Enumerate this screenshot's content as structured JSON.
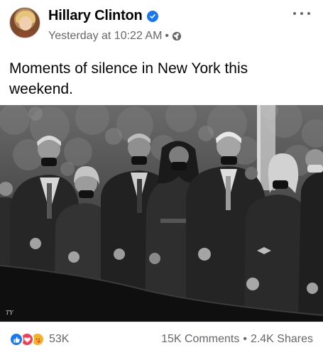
{
  "post": {
    "author": "Hillary Clinton",
    "timestamp": "Yesterday at 10:22 AM",
    "separator": "•",
    "caption": "Moments of silence in New York this weekend.",
    "photo_signature": "TY"
  },
  "footer": {
    "reaction_count": "53K",
    "comments": "15K Comments",
    "dot": "•",
    "shares": "2.4K Shares"
  },
  "icons": {
    "verified": "verified-badge-icon",
    "audience": "globe-icon",
    "menu": "more-options-icon",
    "reactions": [
      "like-icon",
      "love-icon",
      "care-icon"
    ]
  },
  "colors": {
    "brand_blue": "#1877f2",
    "secondary_text": "#65676b",
    "love_red": "#f33e58",
    "care_yellow": "#f7b125"
  }
}
